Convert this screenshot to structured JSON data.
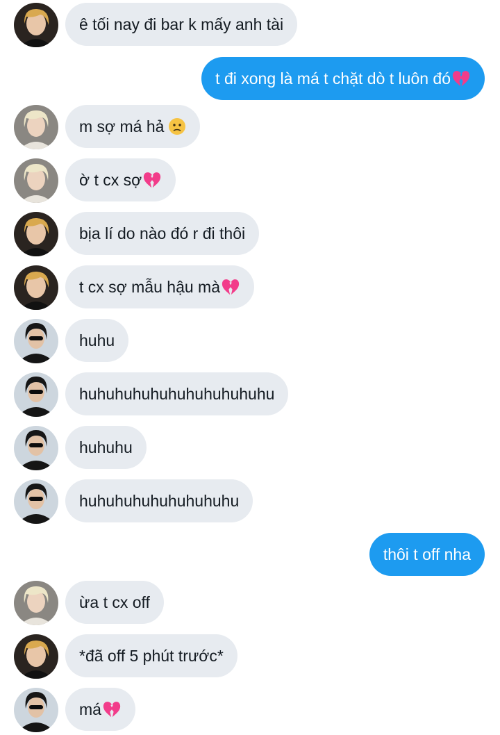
{
  "messages": [
    {
      "side": "in",
      "avatar": "avatar-blonde-boy",
      "text": "ê tối nay đi bar k mấy anh tài",
      "emoji": ""
    },
    {
      "side": "out",
      "avatar": "",
      "text": "t đi xong là má t chặt dò t luôn đó",
      "emoji": "broken-heart-icon"
    },
    {
      "side": "in",
      "avatar": "avatar-platinum-boy",
      "text": "m sợ má hả",
      "emoji": "worried-face-icon"
    },
    {
      "side": "in",
      "avatar": "avatar-platinum-boy",
      "text": "ờ t cx sợ",
      "emoji": "broken-heart-icon"
    },
    {
      "side": "in",
      "avatar": "avatar-blonde-boy",
      "text": "bịa lí do nào đó r đi thôi",
      "emoji": ""
    },
    {
      "side": "in",
      "avatar": "avatar-blonde-boy",
      "text": "t cx sợ mẫu hậu mà",
      "emoji": "broken-heart-icon"
    },
    {
      "side": "in",
      "avatar": "avatar-sunglasses-boy",
      "text": "huhu",
      "emoji": ""
    },
    {
      "side": "in",
      "avatar": "avatar-sunglasses-boy",
      "text": "huhuhuhuhuhuhuhuhuhuhu",
      "emoji": ""
    },
    {
      "side": "in",
      "avatar": "avatar-sunglasses-boy",
      "text": "huhuhu",
      "emoji": ""
    },
    {
      "side": "in",
      "avatar": "avatar-sunglasses-boy",
      "text": "huhuhuhuhuhuhuhuhu",
      "emoji": ""
    },
    {
      "side": "out",
      "avatar": "",
      "text": "thôi t off nha",
      "emoji": ""
    },
    {
      "side": "in",
      "avatar": "avatar-platinum-boy",
      "text": "ừa t cx off",
      "emoji": ""
    },
    {
      "side": "in",
      "avatar": "avatar-blonde-boy",
      "text": "*đã off 5 phút trước*",
      "emoji": ""
    },
    {
      "side": "in",
      "avatar": "avatar-sunglasses-boy",
      "text": "má",
      "emoji": "broken-heart-icon"
    }
  ],
  "colors": {
    "incoming_bubble": "#e7ebf0",
    "outgoing_bubble": "#1d9bf0",
    "incoming_text": "#141b22",
    "outgoing_text": "#ffffff"
  }
}
